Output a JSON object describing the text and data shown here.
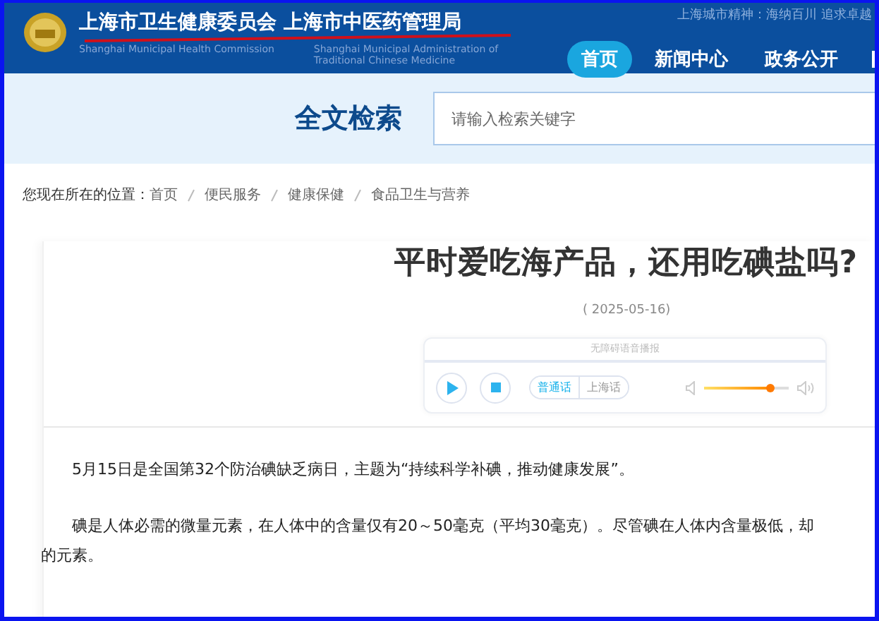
{
  "header": {
    "title_cn": "上海市卫生健康委员会  上海市中医药管理局",
    "subtitle_1": "Shanghai Municipal Health Commission",
    "subtitle_2": "Shanghai Municipal Administration of",
    "subtitle_3": "Traditional Chinese Medicine",
    "slogan": "上海城市精神：海纳百川 追求卓越",
    "nav": [
      {
        "label": "首页",
        "selected": true
      },
      {
        "label": "新闻中心",
        "selected": false
      },
      {
        "label": "政务公开",
        "selected": false
      }
    ]
  },
  "search": {
    "title": "全文检索",
    "placeholder": "请输入检索关键字"
  },
  "breadcrumb": {
    "prefix": "您现在所在的位置：",
    "items": [
      "首页",
      "便民服务",
      "健康保健",
      "食品卫生与营养"
    ]
  },
  "article": {
    "title": "平时爱吃海产品，还用吃碘盐吗?",
    "date": "( 2025-05-16)",
    "player": {
      "caption": "无障碍语音播报",
      "languages": [
        {
          "label": "普通话",
          "selected": true
        },
        {
          "label": "上海话",
          "selected": false
        }
      ],
      "level": 0.78
    },
    "paragraphs": [
      {
        "lines": [
          "5月15日是全国第32个防治碘缺乏病日，主题为“持续科学补碘，推动健康发展”。"
        ]
      },
      {
        "lines": [
          "碘是人体必需的微量元素，在人体中的含量仅有20～50毫克（平均30毫克）。尽管碘在人体内含量极低，却",
          "的元素。"
        ]
      }
    ]
  }
}
